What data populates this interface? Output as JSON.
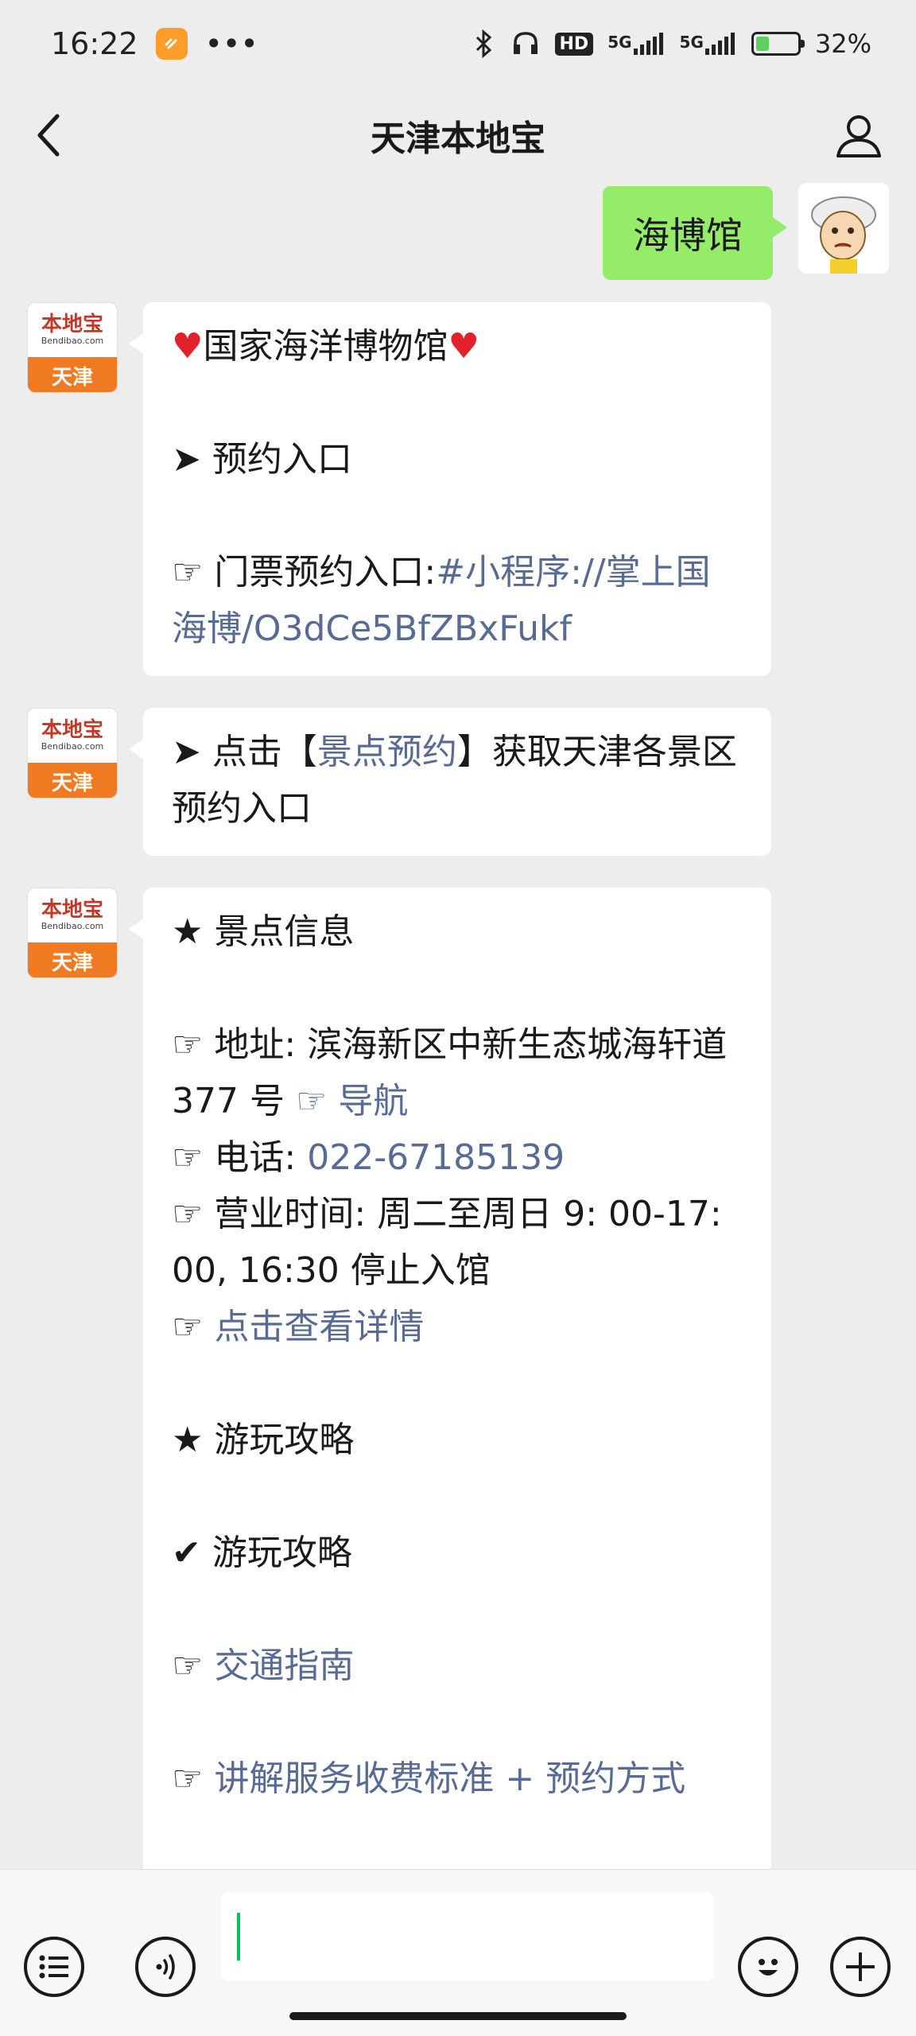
{
  "status_bar": {
    "time": "16:22",
    "dots": "•••",
    "network_1": "5G",
    "network_2": "5G",
    "hd_badge": "HD",
    "battery_percent": "32%",
    "battery_level": 0.32
  },
  "header": {
    "title": "天津本地宝"
  },
  "sent_message": {
    "text": "海博馆"
  },
  "bot_avatar": {
    "line1": "本地宝",
    "line2": "Bendibao.com",
    "line3": "天津"
  },
  "messages": [
    {
      "title": "国家海洋博物馆",
      "heading": "➤ 预约入口",
      "ticket_prefix": "☞ 门票预约入口:",
      "ticket_link": "#小程序://掌上国海博/O3dCe5BfZBxFukf"
    },
    {
      "prefix": "➤ 点击【",
      "link": "景点预约",
      "suffix": "】获取天津各景区预约入口"
    },
    {
      "info_heading": "★ 景点信息",
      "address_prefix": "☞ 地址: 滨海新区中新生态城海轩道 377 号 ",
      "nav_link": "☞ 导航",
      "phone_prefix": "☞ 电话: ",
      "phone_link": "022-67185139",
      "hours": "☞ 营业时间: 周二至周日 9: 00-17: 00, 16:30 停止入馆",
      "detail_prefix": "☞ ",
      "detail_link": "点击查看详情",
      "guide_heading": "★ 游玩攻略",
      "guide_check": "✔ 游玩攻略",
      "traffic_prefix": "☞ ",
      "traffic_link": "交通指南",
      "service_prefix": "☞ ",
      "service_link": "讲解服务收费标准 + 预约方式"
    }
  ],
  "input": {
    "value": ""
  }
}
